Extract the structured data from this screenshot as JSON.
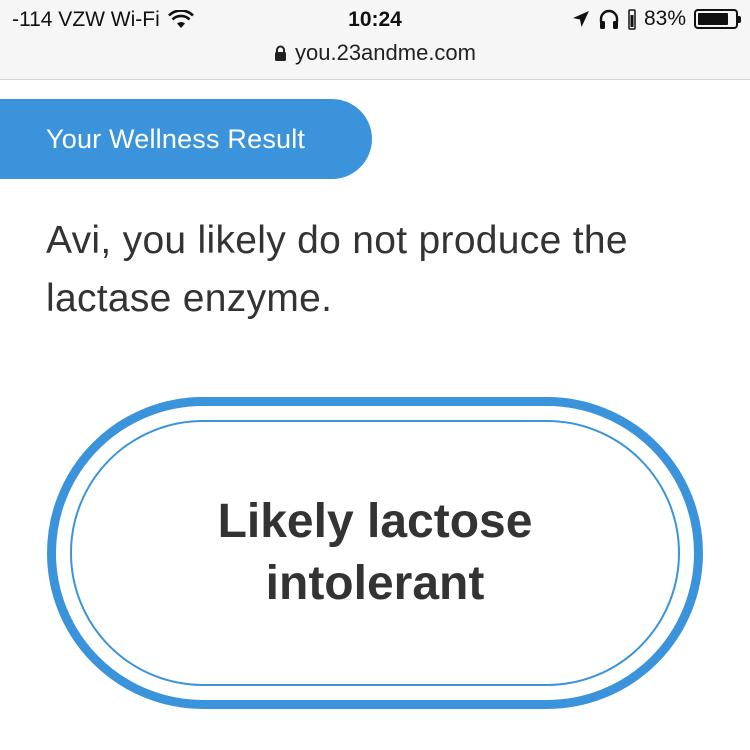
{
  "status_bar": {
    "carrier": "-114 VZW Wi-Fi",
    "time": "10:24",
    "battery_percent": "83%",
    "battery_level": 0.83,
    "icons": [
      "wifi-icon",
      "location-arrow-icon",
      "headphones-icon",
      "battery-icon"
    ]
  },
  "browser": {
    "url": "you.23andme.com",
    "lock_icon": "lock-icon"
  },
  "page": {
    "section_label": "Your Wellness Result",
    "headline": "Avi, you likely do not produce the lactase enzyme.",
    "result": "Likely lactose intolerant"
  },
  "colors": {
    "accent": "#3b94db",
    "text": "#333333",
    "bar_bg": "#f6f6f6"
  }
}
